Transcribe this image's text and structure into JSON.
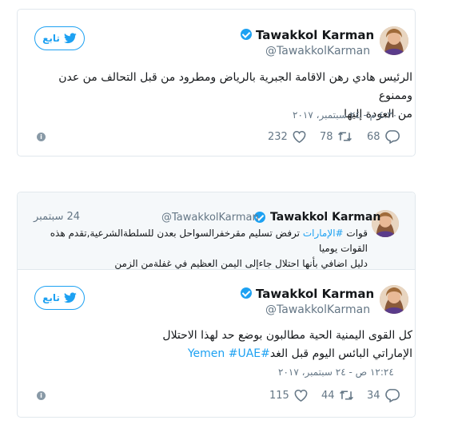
{
  "tweet1": {
    "name": "Tawakkol Karman",
    "handle": "@TawakkolKarman",
    "follow_label": "تابع",
    "text_line1": "الرئيس هادي رهن الاقامة الجبرية بالرياض ومطرود من قبل التحالف من عدن وممنوع",
    "text_line2": "من العودة إليها",
    "timestamp": "٤:٣٠ م - ٢٤ سبتمبر، ٢٠١٧",
    "replies": "68",
    "retweets": "78",
    "likes": "232",
    "icons": [
      "verified-badge-icon",
      "twitter-bird-icon",
      "reply-icon",
      "retweet-icon",
      "heart-icon",
      "info-icon"
    ]
  },
  "tweet2": {
    "quoted": {
      "name": "Tawakkol Karman",
      "handle": "@TawakkolKarman",
      "date": "24 سبتمبر",
      "line1_prefix": "قوات",
      "line1_hashtag": "#الإمارات",
      "line1_suffix": "ترفض تسليم مقرخفرالسواحل بعدن للسلطةالشرعية,تقدم هذه القوات يوميا",
      "line2": "دليل اضافي بأنها احتلال جاءإلى اليمن العظيم في غفلةمن الزمن"
    },
    "name": "Tawakkol Karman",
    "handle": "@TawakkolKarman",
    "follow_label": "تابع",
    "text_line1": "كل القوى اليمنية الحية مطالبون بوضع حد لهذا الاحتلال",
    "text_line2": "الإماراتي البائس اليوم قبل الغد",
    "hashtag_yemen": "#Yemen",
    "hashtag_uae": "#UAE",
    "timestamp": "١٢:٢٤ ص - ٢٤ سبتمبر، ٢٠١٧",
    "replies": "34",
    "retweets": "44",
    "likes": "115"
  },
  "colors": {
    "accent": "#1da1f2",
    "muted": "#657786",
    "border": "#e1e8ed",
    "quote_bg": "#f5f8fa"
  }
}
